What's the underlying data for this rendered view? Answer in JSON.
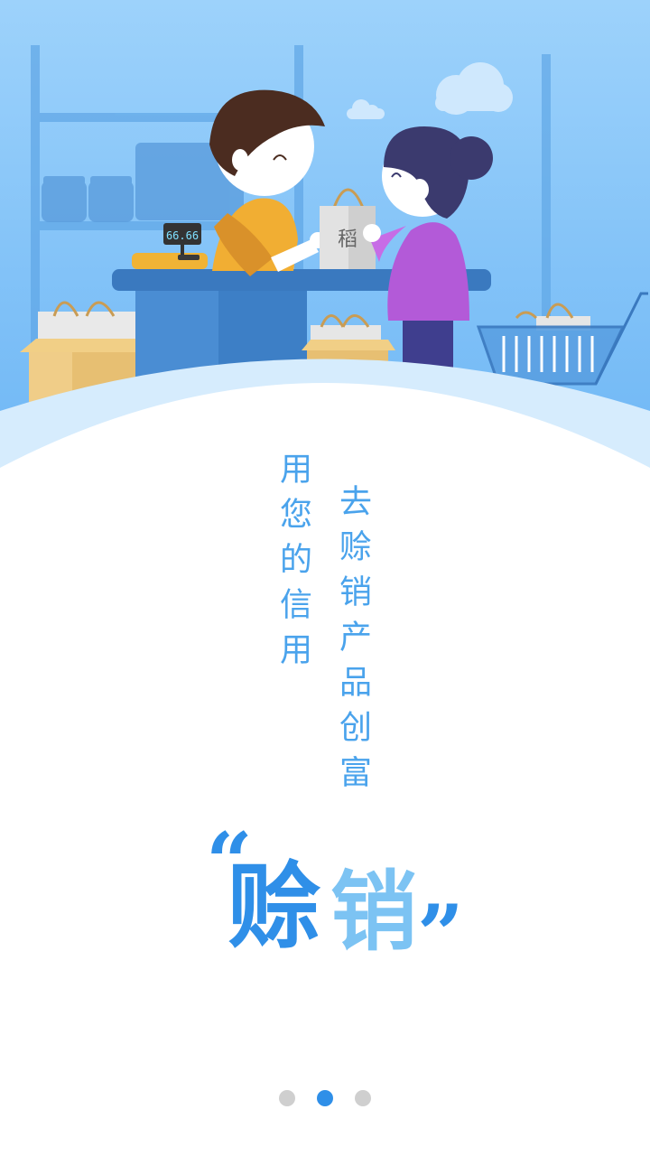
{
  "scene": {
    "scale_reading": "66.66",
    "bag_label": "稻"
  },
  "text": {
    "line_left": "用您的信用",
    "line_right": "去赊销产品创富"
  },
  "slogan": {
    "quote_open": "“",
    "word_1": "赊",
    "word_2": "销",
    "quote_close": "”"
  },
  "pager": {
    "count": 3,
    "active_index": 1
  },
  "colors": {
    "primary": "#2f8fe8",
    "secondary": "#7cc3f3",
    "text_blue": "#4aa3ec",
    "dot_inactive": "#cfcfcf"
  }
}
